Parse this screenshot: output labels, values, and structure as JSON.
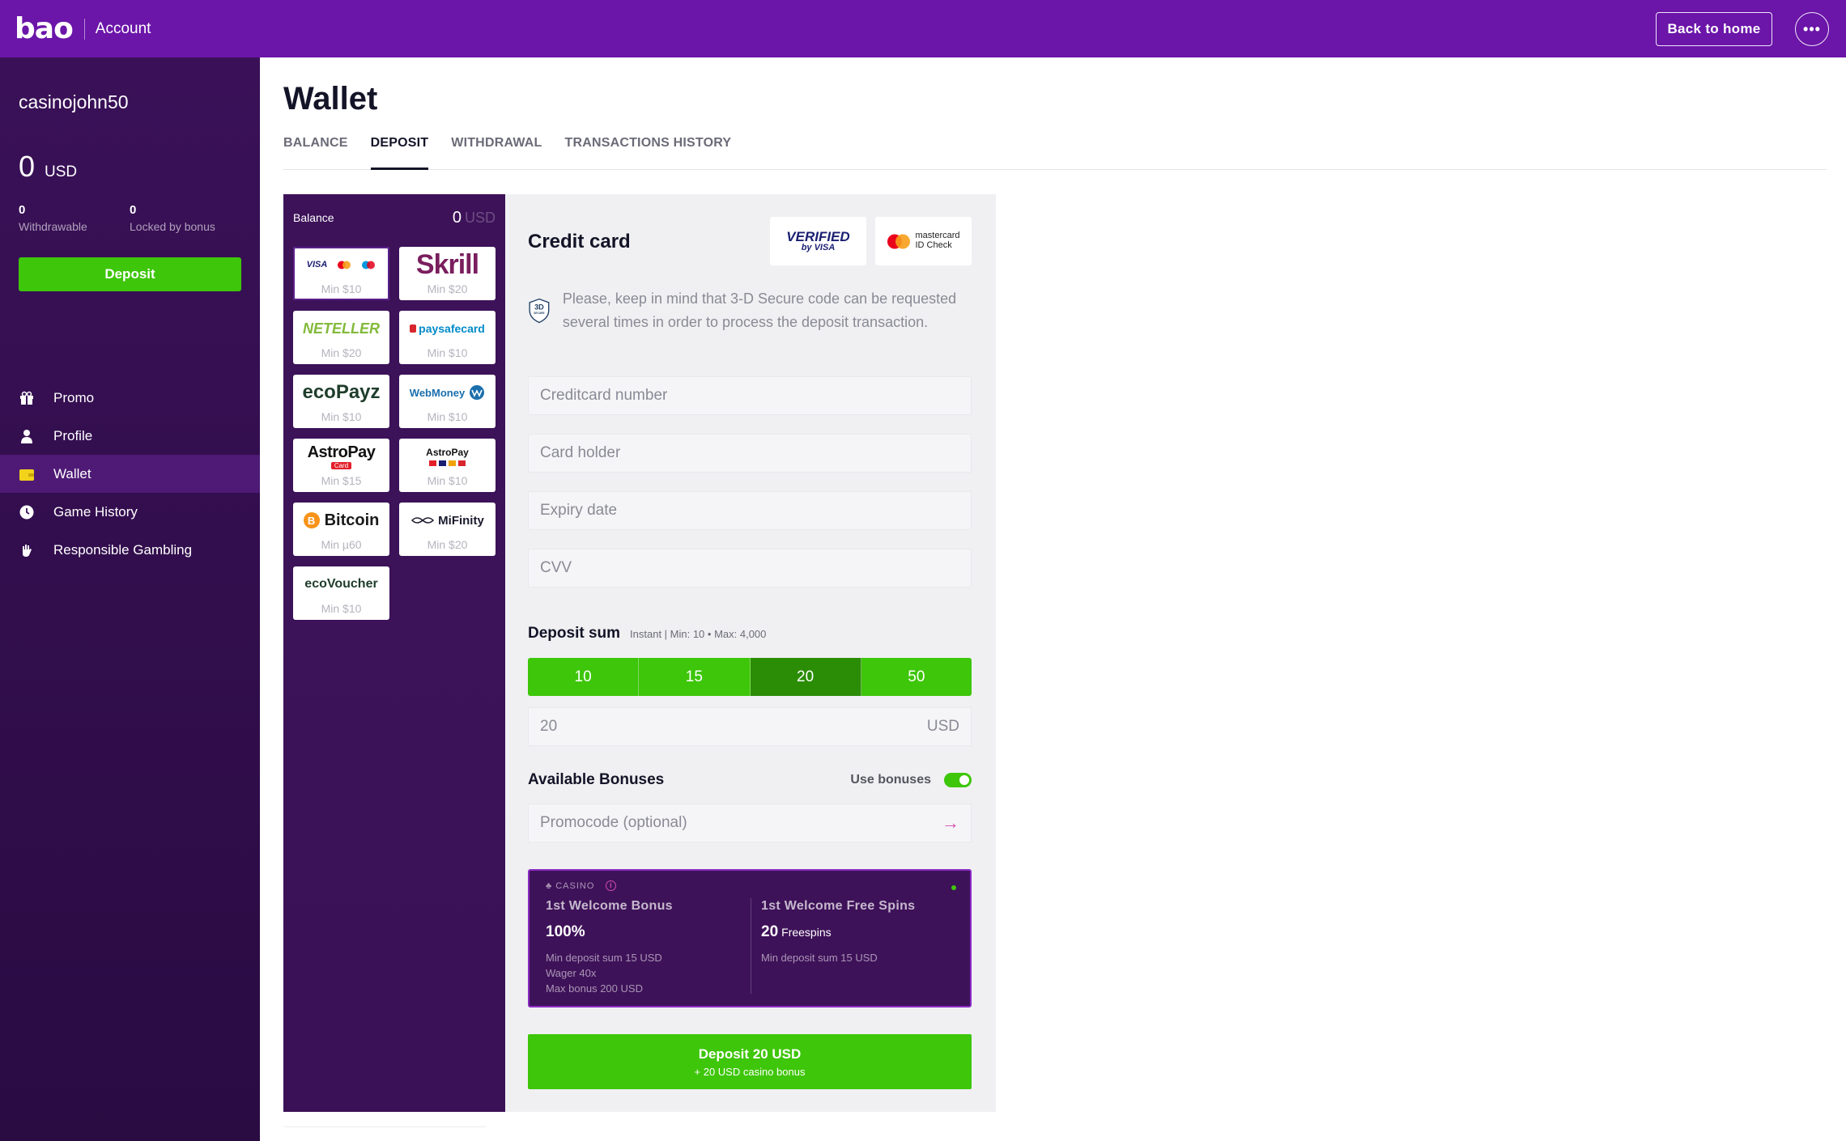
{
  "header": {
    "logo": "bao",
    "section": "Account",
    "back_label": "Back to home",
    "more_label": "•••"
  },
  "sidebar": {
    "username": "casinojohn50",
    "balance": "0",
    "currency": "USD",
    "withdrawable_value": "0",
    "withdrawable_label": "Withdrawable",
    "locked_value": "0",
    "locked_label": "Locked by bonus",
    "deposit_label": "Deposit",
    "nav": [
      {
        "label": "Promo",
        "icon": "gift-icon"
      },
      {
        "label": "Profile",
        "icon": "user-icon"
      },
      {
        "label": "Wallet",
        "icon": "wallet-icon",
        "active": true
      },
      {
        "label": "Game History",
        "icon": "clock-icon"
      },
      {
        "label": "Responsible Gambling",
        "icon": "hand-icon"
      }
    ]
  },
  "page": {
    "title": "Wallet",
    "tabs": [
      "BALANCE",
      "DEPOSIT",
      "WITHDRAWAL",
      "TRANSACTIONS HISTORY"
    ],
    "active_tab": "DEPOSIT"
  },
  "methods": {
    "balance_label": "Balance",
    "balance_value": "0",
    "balance_currency": "USD",
    "items": [
      {
        "name": "Visa / Mastercard",
        "min": "Min $10"
      },
      {
        "name": "Skrill",
        "min": "Min $20"
      },
      {
        "name": "NETELLER",
        "min": "Min $20"
      },
      {
        "name": "paysafecard",
        "min": "Min $10"
      },
      {
        "name": "ecoPayz",
        "min": "Min $10"
      },
      {
        "name": "WebMoney",
        "min": "Min $10"
      },
      {
        "name": "AstroPay",
        "min": "Min $15"
      },
      {
        "name": "AstroPay",
        "min": "Min $10"
      },
      {
        "name": "Bitcoin",
        "min": "Min µ60"
      },
      {
        "name": "MiFinity",
        "min": "Min $20"
      },
      {
        "name": "ecoVoucher",
        "min": "Min $10"
      }
    ],
    "logo_text": {
      "visa": "VISA",
      "skrill": "Skrill",
      "neteller": "NETELLER",
      "paysafe": "paysafecard",
      "ecopayz": "ecoPayz",
      "webmoney": "WebMoney",
      "astropay": "AstroPay",
      "astropay_card": "Card",
      "bitcoin": "Bitcoin",
      "mifinity": "MiFinity",
      "ecovoucher": "ecoVoucher"
    }
  },
  "form": {
    "title": "Credit card",
    "badge_visa_line1": "VERIFIED",
    "badge_visa_line2": "by VISA",
    "badge_mc_line1": "mastercard",
    "badge_mc_line2": "ID Check",
    "secure_label": "3D",
    "secure_sub": "SECURE",
    "notice": "Please, keep in mind that 3-D Secure code can be requested several times in order to process the deposit transaction.",
    "fields": {
      "card_number": "Creditcard number",
      "card_holder": "Card holder",
      "expiry": "Expiry date",
      "cvv": "CVV"
    },
    "deposit_sum_label": "Deposit sum",
    "deposit_sum_hint": "Instant | Min: 10 • Max: 4,000",
    "amounts": [
      "10",
      "15",
      "20",
      "50"
    ],
    "selected_amount": "20",
    "sum_value": "20",
    "sum_currency": "USD",
    "bonuses_label": "Available Bonuses",
    "use_bonuses_label": "Use bonuses",
    "use_bonuses_on": true,
    "promo_placeholder": "Promocode (optional)",
    "bonus": {
      "tag": "CASINO",
      "left_title": "1st Welcome Bonus",
      "left_value": "100%",
      "left_details": [
        "Min deposit sum 15 USD",
        "Wager 40x",
        "Max bonus 200 USD"
      ],
      "right_title": "1st Welcome Free Spins",
      "right_value": "20",
      "right_unit": "Freespins",
      "right_details": [
        "Min deposit sum 15 USD"
      ]
    },
    "cta_label": "Deposit 20 USD",
    "cta_sub": "+ 20 USD casino bonus"
  },
  "colors": {
    "topbar": "#6b15a9",
    "sidebar": "#2f0d4a",
    "green": "#3ec60a",
    "green_selected": "#2a8d05",
    "bonus_border": "#8a2bc5"
  }
}
